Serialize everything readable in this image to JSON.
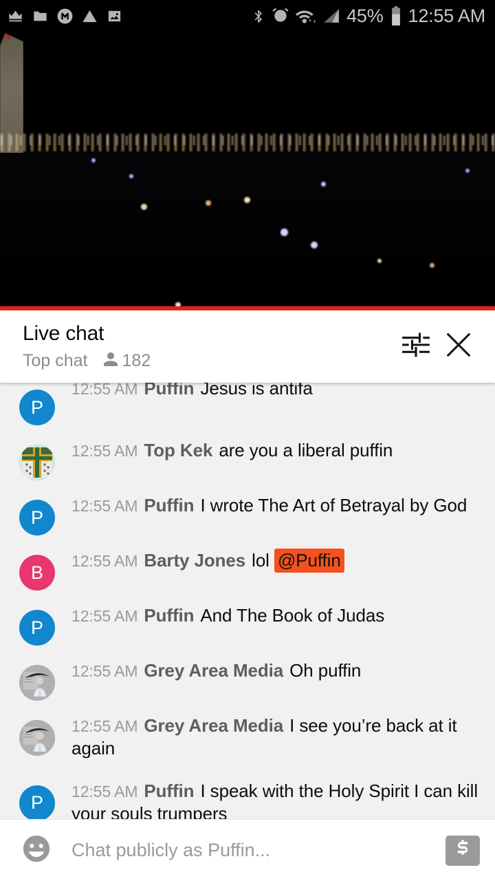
{
  "status_bar": {
    "icons_left": [
      "crown-icon",
      "folder-icon",
      "mega-m-icon",
      "warning-triangle-icon",
      "image-icon"
    ],
    "icons_right": [
      "bluetooth-icon",
      "alarm-icon",
      "wifi-icon",
      "cellular-signal-icon",
      "battery-icon"
    ],
    "battery_percent": "45%",
    "time": "12:55 AM"
  },
  "video": {
    "description": "night city skyline with Washington Monument",
    "progress_color": "#E62117",
    "progress_percent": 100
  },
  "chat_header": {
    "title": "Live chat",
    "subtitle": "Top chat",
    "viewer_count": "182",
    "viewer_icon": "person-icon",
    "settings_icon": "tune-sliders-icon",
    "close_icon": "close-x-icon"
  },
  "colors": {
    "mention_bg": "#F4511E",
    "avatar_blue": "#1287CE",
    "avatar_pink": "#E8366F",
    "avatar_grey": "#A8A8A8",
    "chat_bg": "#F1F1F1",
    "author_text": "#5E5E5E",
    "timestamp_text": "#9A9A9A"
  },
  "messages": [
    {
      "timestamp": "12:55 AM",
      "author": "Puffin",
      "text": "Jesus is antifa",
      "avatar_type": "letter",
      "avatar_letter": "P",
      "avatar_color": "#1287CE",
      "mention": null,
      "clipped": true
    },
    {
      "timestamp": "12:55 AM",
      "author": "Top Kek",
      "text": "are you a liberal puffin",
      "avatar_type": "photo-crusader-shield",
      "avatar_letter": "",
      "avatar_color": "#7D7A4A",
      "mention": null,
      "clipped": false
    },
    {
      "timestamp": "12:55 AM",
      "author": "Puffin",
      "text": "I wrote The Art of Betrayal by God",
      "avatar_type": "letter",
      "avatar_letter": "P",
      "avatar_color": "#1287CE",
      "mention": null,
      "clipped": false
    },
    {
      "timestamp": "12:55 AM",
      "author": "Barty Jones",
      "text": "lol ",
      "avatar_type": "letter",
      "avatar_letter": "B",
      "avatar_color": "#E8366F",
      "mention": "@Puffin",
      "clipped": false
    },
    {
      "timestamp": "12:55 AM",
      "author": "Puffin",
      "text": "And The Book of Judas",
      "avatar_type": "letter",
      "avatar_letter": "P",
      "avatar_color": "#1287CE",
      "mention": null,
      "clipped": false
    },
    {
      "timestamp": "12:55 AM",
      "author": "Grey Area Media",
      "text": "Oh puffin",
      "avatar_type": "photo-person-grey",
      "avatar_letter": "",
      "avatar_color": "#A8A8A8",
      "mention": null,
      "clipped": false
    },
    {
      "timestamp": "12:55 AM",
      "author": "Grey Area Media",
      "text": "I see you’re back at it again",
      "avatar_type": "photo-person-grey",
      "avatar_letter": "",
      "avatar_color": "#A8A8A8",
      "mention": null,
      "clipped": false
    },
    {
      "timestamp": "12:55 AM",
      "author": "Puffin",
      "text": "I speak with the Holy Spirit I can kill your souls trumpers",
      "avatar_type": "letter",
      "avatar_letter": "P",
      "avatar_color": "#1287CE",
      "mention": null,
      "clipped": false
    }
  ],
  "input_bar": {
    "emoji_icon": "emoji-smiley-icon",
    "placeholder": "Chat publicly as Puffin...",
    "value": "",
    "superchat_icon": "dollar-sign-icon"
  }
}
